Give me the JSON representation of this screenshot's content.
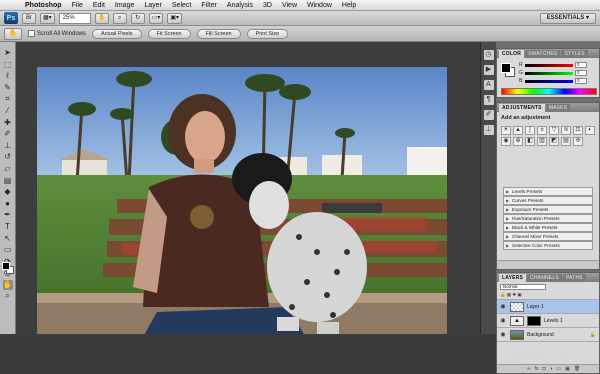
{
  "menubar": {
    "app_name": "Photoshop",
    "items": [
      "File",
      "Edit",
      "Image",
      "Layer",
      "Select",
      "Filter",
      "Analysis",
      "3D",
      "View",
      "Window",
      "Help"
    ]
  },
  "appbar": {
    "logo": "Ps",
    "zoom": "25%",
    "workspace": "ESSENTIALS ▾"
  },
  "options": {
    "tool_icon": "hand-icon",
    "scroll_all_windows": "Scroll All Windows",
    "buttons": [
      "Actual Pixels",
      "Fit Screen",
      "Fill Screen",
      "Print Size"
    ]
  },
  "color_panel": {
    "tabs": [
      "COLOR",
      "SWATCHES",
      "STYLES"
    ],
    "active_tab": "COLOR",
    "fg_color": "#000000",
    "bg_color": "#ffffff",
    "sliders": [
      {
        "label": "R",
        "value": "0"
      },
      {
        "label": "G",
        "value": "0"
      },
      {
        "label": "B",
        "value": "0"
      }
    ]
  },
  "adjustments_panel": {
    "tabs": [
      "ADJUSTMENTS",
      "MASKS"
    ],
    "active_tab": "ADJUSTMENTS",
    "title": "Add an adjustment",
    "presets": [
      "Levels Presets",
      "Curves Presets",
      "Exposure Presets",
      "Hue/Saturation Presets",
      "Black & White Presets",
      "Channel Mixer Presets",
      "Selective Color Presets"
    ]
  },
  "layers_panel": {
    "tabs": [
      "LAYERS",
      "CHANNELS",
      "PATHS"
    ],
    "active_tab": "LAYERS",
    "blend_mode": "Normal",
    "layers": [
      {
        "name": "Layer 1",
        "selected": true
      },
      {
        "name": "Levels 1",
        "selected": false
      },
      {
        "name": "Background",
        "selected": false
      }
    ]
  },
  "watermark": {
    "brand": "lynda",
    "suffix": ".com"
  },
  "colors": {
    "accent_selected_layer": "#a9c4ea",
    "workspace_bg": "#3b3b3b"
  }
}
